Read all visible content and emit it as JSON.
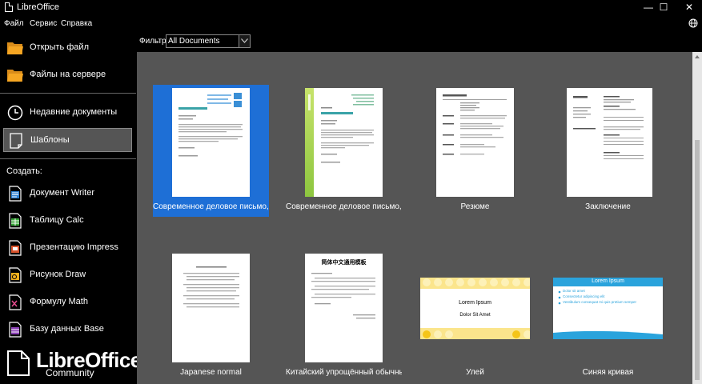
{
  "window": {
    "title": "LibreOffice",
    "minimize": "—",
    "maximize": "☐",
    "close": "✕"
  },
  "menu": [
    "Файл",
    "Сервис",
    "Справка"
  ],
  "sidebar": {
    "open_file": "Открыть файл",
    "remote_files": "Файлы на сервере",
    "recent": "Недавние документы",
    "templates": "Шаблоны",
    "create_label": "Создать:",
    "writer": "Документ Writer",
    "calc": "Таблицу Calc",
    "impress": "Презентацию Impress",
    "draw": "Рисунок Draw",
    "math": "Формулу Math",
    "base": "Базу данных Base"
  },
  "logo": {
    "name": "LibreOffice",
    "edition": "Community"
  },
  "filter": {
    "label": "Фильтр:",
    "value": "All Documents"
  },
  "templates": [
    {
      "caption": "Современное деловое письмо,...",
      "selected": true
    },
    {
      "caption": "Современное деловое письмо,..."
    },
    {
      "caption": "Резюме"
    },
    {
      "caption": "Заключение"
    },
    {
      "caption": "Japanese normal"
    },
    {
      "caption": "Китайский упрощённый обычный",
      "thumb_title": "简体中文通用模板"
    },
    {
      "caption": "Улей",
      "thumb_text1": "Lorem Ipsum",
      "thumb_text2": "Dolor Sit Amet"
    },
    {
      "caption": "Синяя кривая",
      "thumb_title": "Lorem Ipsum",
      "thumb_lines": [
        "Dolor sit amet",
        "Consectetur adipiscing elit",
        "Vestibulum consequat mi quis pretium semper"
      ]
    }
  ],
  "colors": {
    "selection": "#1e6fd6",
    "accent_green": "#8dc63f",
    "beehive_yellow": "#fbe58c",
    "blue_curve": "#2aa3dc"
  }
}
